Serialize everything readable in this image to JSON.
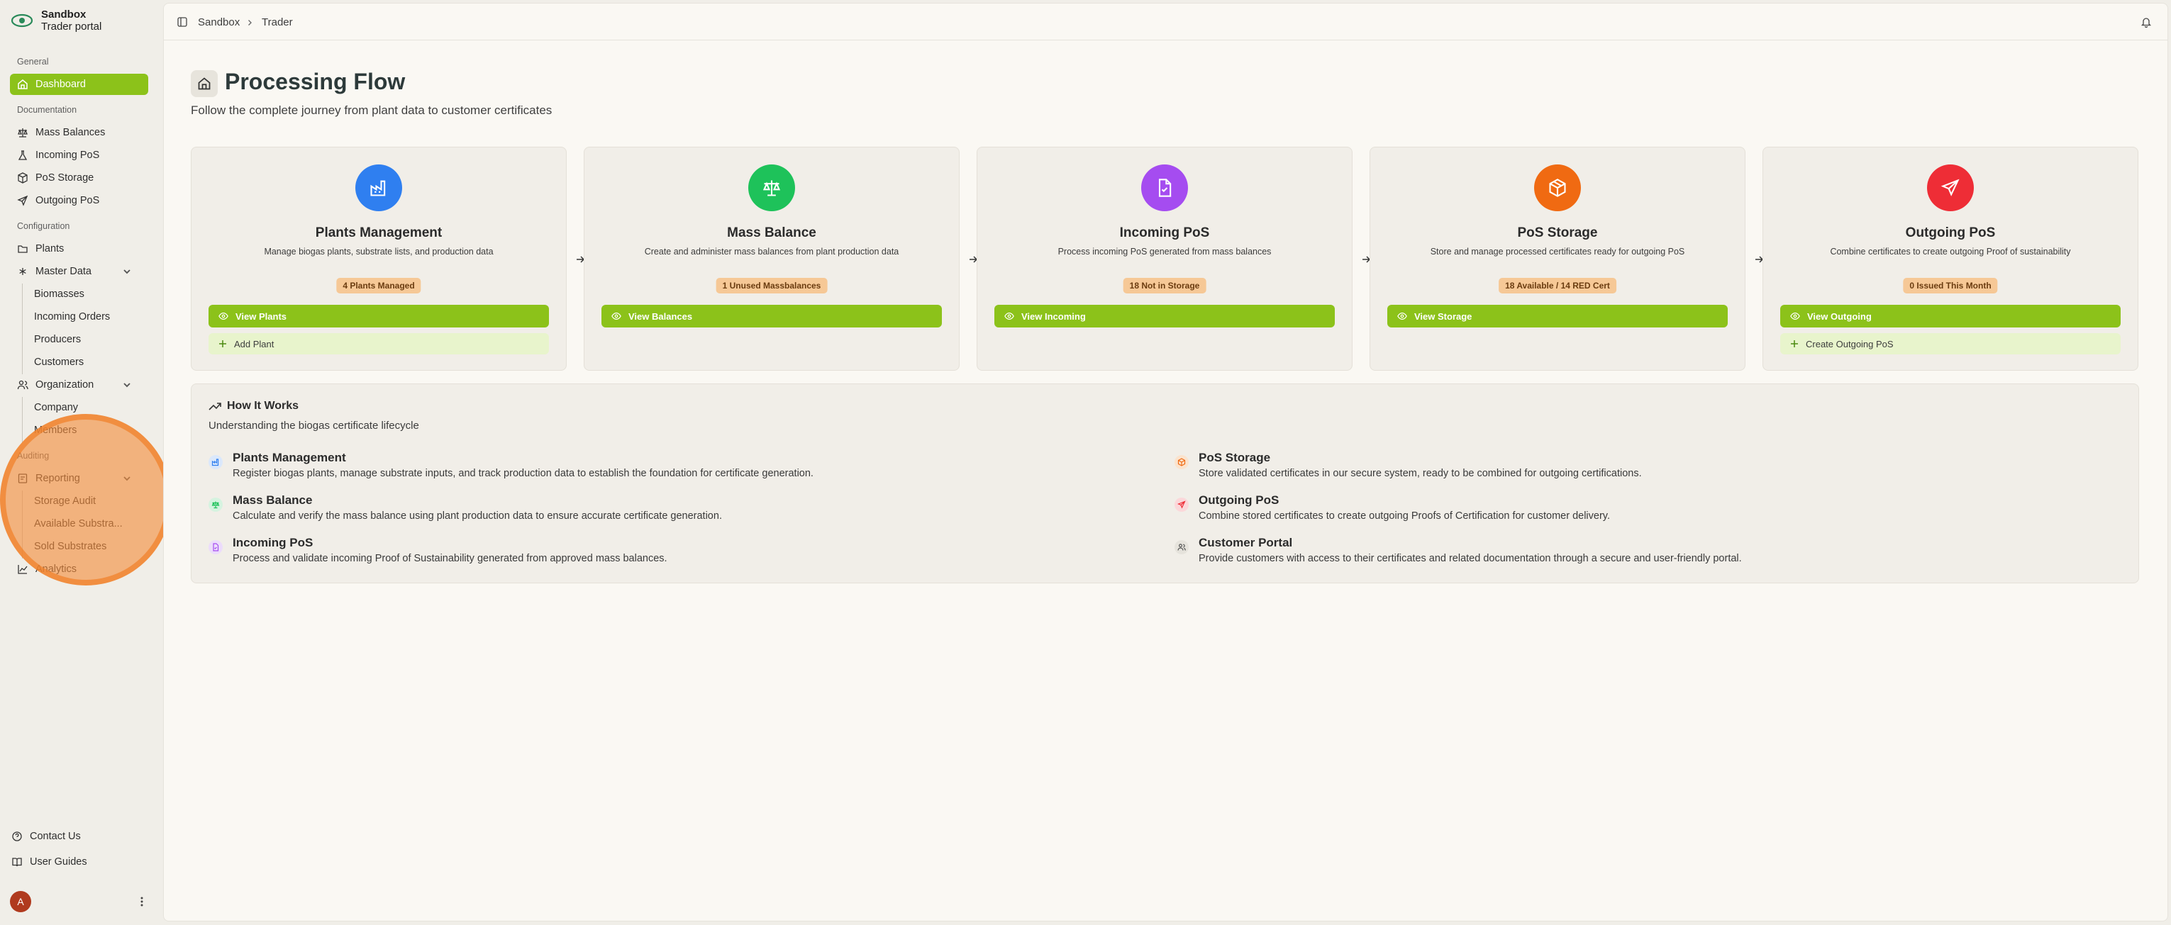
{
  "app": {
    "name": "Sandbox",
    "subtitle": "Trader portal"
  },
  "sidebar": {
    "sections": {
      "general": "General",
      "documentation": "Documentation",
      "configuration": "Configuration",
      "auditing": "Auditing"
    },
    "dashboard": "Dashboard",
    "documentation": [
      "Mass Balances",
      "Incoming PoS",
      "PoS Storage",
      "Outgoing PoS"
    ],
    "plants": "Plants",
    "master_data": {
      "label": "Master Data",
      "items": [
        "Biomasses",
        "Incoming Orders",
        "Producers",
        "Customers"
      ]
    },
    "organization": {
      "label": "Organization",
      "items": [
        "Company",
        "Members"
      ]
    },
    "reporting": {
      "label": "Reporting",
      "items": [
        "Storage Audit",
        "Available Substra...",
        "Sold Substrates"
      ]
    },
    "analytics": "Analytics",
    "contact": "Contact Us",
    "guides": "User Guides",
    "avatar_initial": "A"
  },
  "breadcrumb": [
    "Sandbox",
    "Trader"
  ],
  "page": {
    "title": "Processing Flow",
    "subtitle": "Follow the complete journey from plant data to customer certificates"
  },
  "cards": [
    {
      "title": "Plants Management",
      "desc": "Manage biogas plants, substrate lists, and production data",
      "badge": "4 Plants Managed",
      "primary": "View Plants",
      "secondary": "Add Plant",
      "color": "#2f7ff0",
      "icon": "factory-icon"
    },
    {
      "title": "Mass Balance",
      "desc": "Create and administer mass balances from plant production data",
      "badge": "1 Unused Massbalances",
      "primary": "View Balances",
      "secondary": "",
      "color": "#1ec25a",
      "icon": "scale-icon"
    },
    {
      "title": "Incoming PoS",
      "desc": "Process incoming PoS generated from mass balances",
      "badge": "18 Not in Storage",
      "primary": "View Incoming",
      "secondary": "",
      "color": "#a54cf0",
      "icon": "document-check-icon"
    },
    {
      "title": "PoS Storage",
      "desc": "Store and manage processed certificates ready for outgoing PoS",
      "badge": "18 Available / 14 RED Cert",
      "primary": "View Storage",
      "secondary": "",
      "color": "#f06a12",
      "icon": "package-icon"
    },
    {
      "title": "Outgoing PoS",
      "desc": "Combine certificates to create outgoing Proof of sustainability",
      "badge": "0 Issued This Month",
      "primary": "View Outgoing",
      "secondary": "Create Outgoing PoS",
      "color": "#ee2d36",
      "icon": "send-icon"
    }
  ],
  "how": {
    "title": "How It Works",
    "subtitle": "Understanding the biogas certificate lifecycle",
    "items": [
      {
        "title": "Plants Management",
        "desc": "Register biogas plants, manage substrate inputs, and track production data to establish the foundation for certificate generation."
      },
      {
        "title": "Mass Balance",
        "desc": "Calculate and verify the mass balance using plant production data to ensure accurate certificate generation."
      },
      {
        "title": "Incoming PoS",
        "desc": "Process and validate incoming Proof of Sustainability generated from approved mass balances."
      },
      {
        "title": "PoS Storage",
        "desc": "Store validated certificates in our secure system, ready to be combined for outgoing certifications."
      },
      {
        "title": "Outgoing PoS",
        "desc": "Combine stored certificates to create outgoing Proofs of Certification for customer delivery."
      },
      {
        "title": "Customer Portal",
        "desc": "Provide customers with access to their certificates and related documentation through a secure and user-friendly portal."
      }
    ]
  }
}
